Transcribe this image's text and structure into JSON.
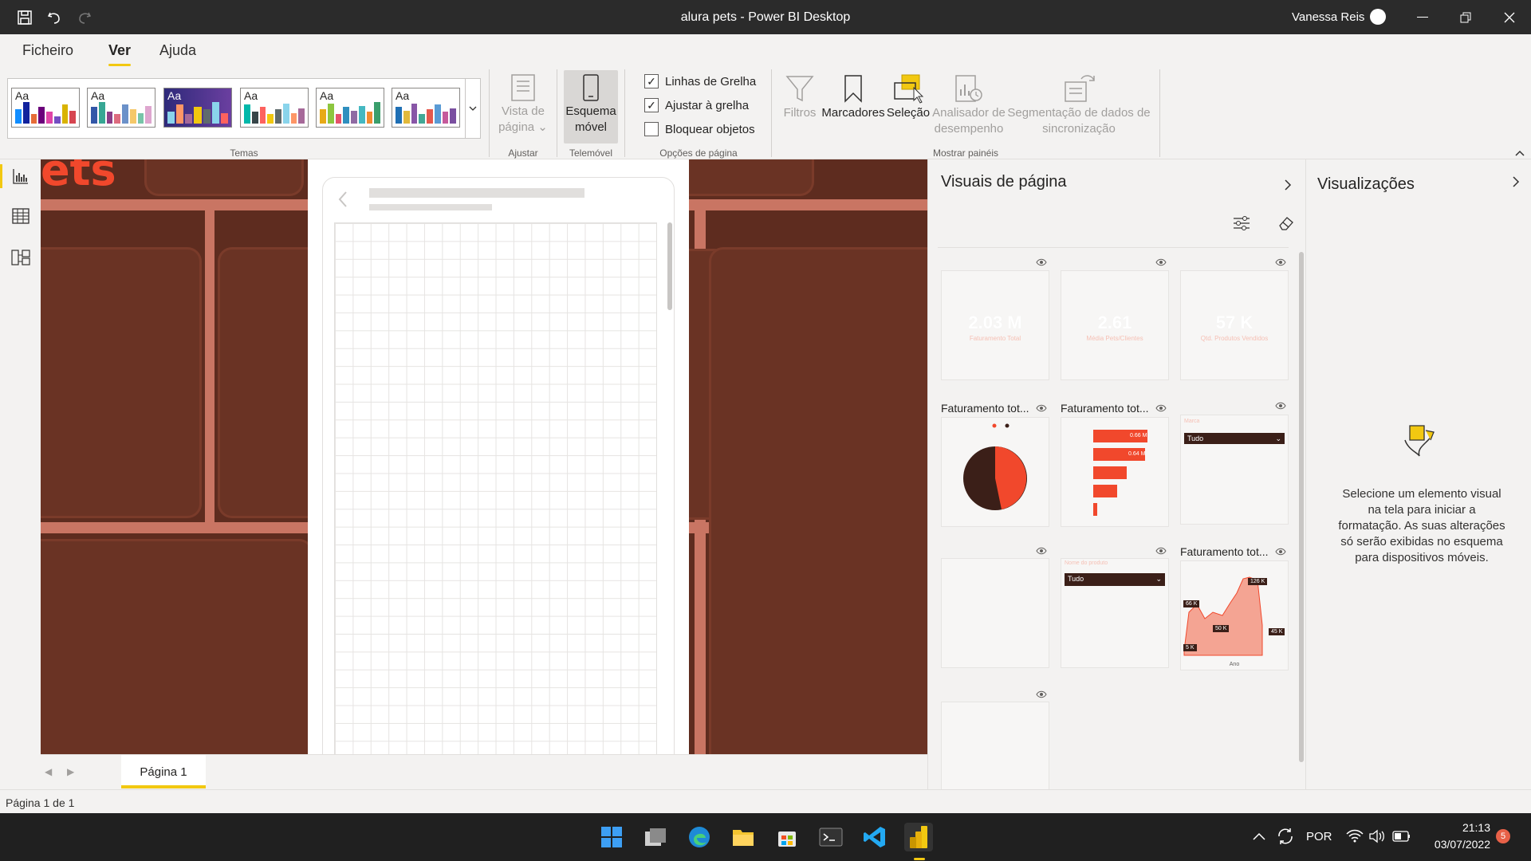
{
  "titlebar": {
    "title": "alura pets - Power BI Desktop",
    "user": "Vanessa Reis",
    "icons": [
      "save-icon",
      "undo-icon",
      "redo-icon"
    ],
    "window_buttons": [
      "minimize-icon",
      "restore-icon",
      "close-icon"
    ]
  },
  "ribbon_tabs": [
    "Ficheiro",
    "Ver",
    "Ajuda"
  ],
  "ribbon": {
    "themes_label": "Temas",
    "theme_aa": "Aa",
    "page_view": [
      "Vista de",
      "página"
    ],
    "ajustar_label": "Ajustar",
    "mobile_layout": [
      "Esquema",
      "móvel"
    ],
    "telemovel_label": "Telemóvel",
    "checkboxes": [
      {
        "label": "Linhas de Grelha",
        "checked": true
      },
      {
        "label": "Ajustar à grelha",
        "checked": true
      },
      {
        "label": "Bloquear objetos",
        "checked": false
      }
    ],
    "page_options_label": "Opções de página",
    "filters": "Filtros",
    "bookmarks": "Marcadores",
    "selection": "Seleção",
    "performance": [
      "Analisador de",
      "desempenho"
    ],
    "sync": [
      "Segmentação de dados de",
      "sincronização"
    ],
    "show_panes_label": "Mostrar painéis"
  },
  "canvas": {
    "logo_text": "ets"
  },
  "page_tab": "Página 1",
  "status": "Página 1 de 1",
  "visuals_pane": {
    "title": "Visuais de página",
    "tiles": {
      "kpi1_value": "2.03 M",
      "kpi1_label": "Faturamento Total",
      "kpi2_value": "2.61",
      "kpi2_label": "Média Pets/Clientes",
      "kpi3_value": "57 K",
      "kpi3_label": "Qtd. Produtos Vendidos",
      "pie_title": "Faturamento tot...",
      "bar_title": "Faturamento tot...",
      "bar_labels": [
        "0.66 M",
        "0.64 M"
      ],
      "slicer1_header": "Marca",
      "slicer1_value": "Tudo",
      "slicer2_header": "Nome do produto",
      "slicer2_value": "Tudo",
      "area_title": "Faturamento tot...",
      "area_labels": [
        "126 K",
        "66 K",
        "50 K",
        "45 K",
        "5 K"
      ],
      "area_axis": "Ano"
    }
  },
  "viz_pane": {
    "title": "Visualizações",
    "message": "Selecione um elemento visual na tela para iniciar a formatação. As suas alterações só serão exibidas no esquema para dispositivos móveis."
  },
  "taskbar": {
    "lang": "POR",
    "time": "21:13",
    "date": "03/07/2022",
    "badge": "5"
  }
}
